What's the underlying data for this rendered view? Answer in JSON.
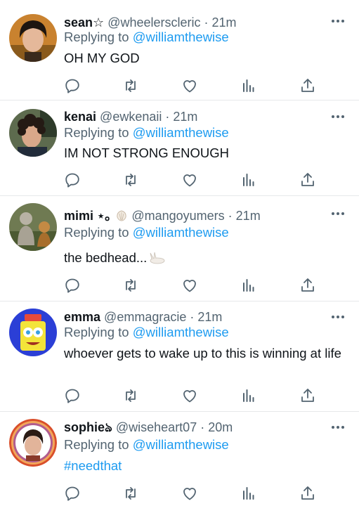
{
  "colors": {
    "link": "#1d9bf0",
    "secondary": "#536471",
    "primary": "#0f1419",
    "divider": "#e6e8ea"
  },
  "replies": [
    {
      "display_name": "sean☆",
      "handle": "@wheelerscleric",
      "time": "21m",
      "replying_prefix": "Replying to",
      "replying_to": "@williamthewise",
      "text": "OH MY GOD",
      "avatar_icon": "avatar-dark-hair-portrait"
    },
    {
      "display_name": "kenai",
      "handle": "@ewkenaii",
      "time": "21m",
      "replying_prefix": "Replying to",
      "replying_to": "@williamthewise",
      "text": "IM NOT STRONG ENOUGH",
      "avatar_icon": "avatar-curly-hair-portrait"
    },
    {
      "display_name": "mimi ⋆｡",
      "handle": "@mangoyumers",
      "time": "21m",
      "replying_prefix": "Replying to",
      "replying_to": "@williamthewise",
      "text": "the bedhead...",
      "avatar_icon": "avatar-statue-garden",
      "name_emoji": "shell-icon",
      "text_emoji": "bunny-sleeping-icon"
    },
    {
      "display_name": "emma",
      "handle": "@emmagracie",
      "time": "21m",
      "replying_prefix": "Replying to",
      "replying_to": "@williamthewise",
      "text": "whoever gets to wake up to this is winning at life",
      "avatar_icon": "avatar-sponge-cartoon"
    },
    {
      "display_name": "sophieঌ",
      "handle": "@wiseheart07",
      "time": "20m",
      "replying_prefix": "Replying to",
      "replying_to": "@williamthewise",
      "text": "#needthat",
      "avatar_icon": "avatar-portrait-pride-ring"
    }
  ]
}
